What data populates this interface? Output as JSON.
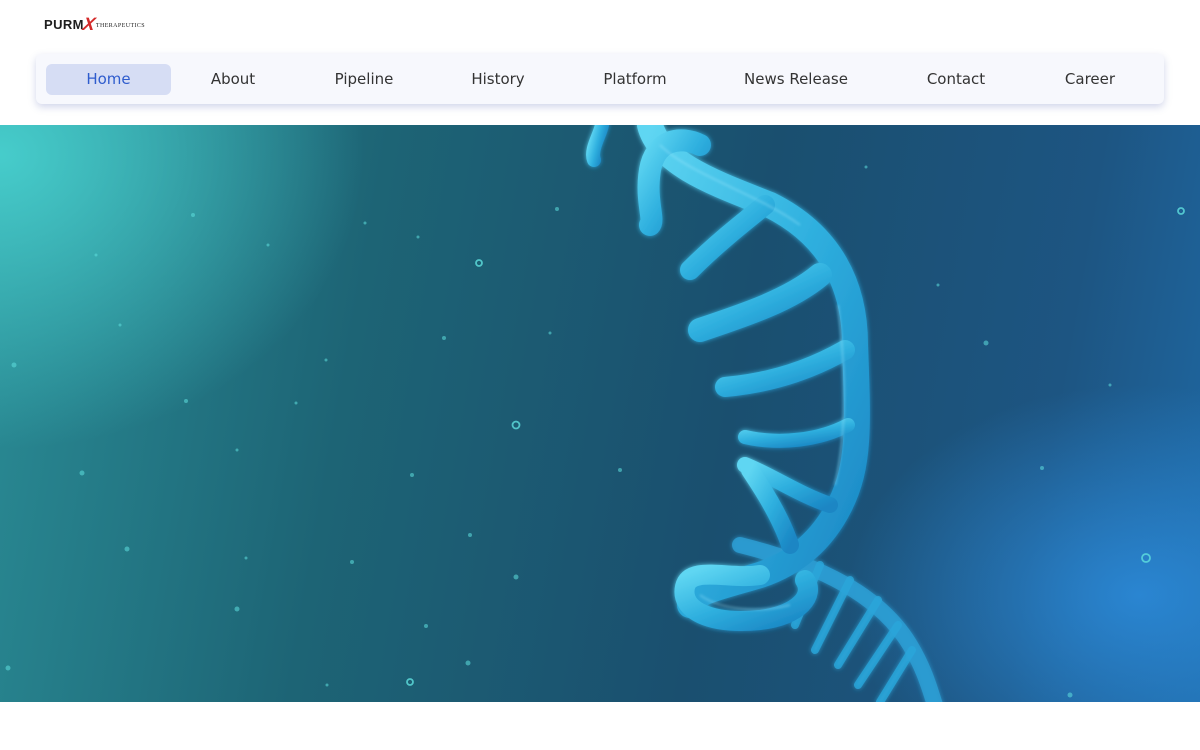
{
  "logo": {
    "part1": "PURM",
    "part2": "X",
    "part3": "Therapeutics"
  },
  "nav": {
    "items": [
      {
        "label": "Home",
        "active": true
      },
      {
        "label": "About"
      },
      {
        "label": "Pipeline"
      },
      {
        "label": "History"
      },
      {
        "label": "Platform"
      },
      {
        "label": "News Release"
      },
      {
        "label": "Contact"
      },
      {
        "label": "Career"
      }
    ]
  },
  "colors": {
    "nav_active_bg": "#d6ddf4",
    "nav_active_text": "#2f5ccd",
    "logo_accent": "#d42a2a",
    "helix": "#3cc2ea"
  },
  "hero": {
    "image": "rna-strand-illustration"
  }
}
